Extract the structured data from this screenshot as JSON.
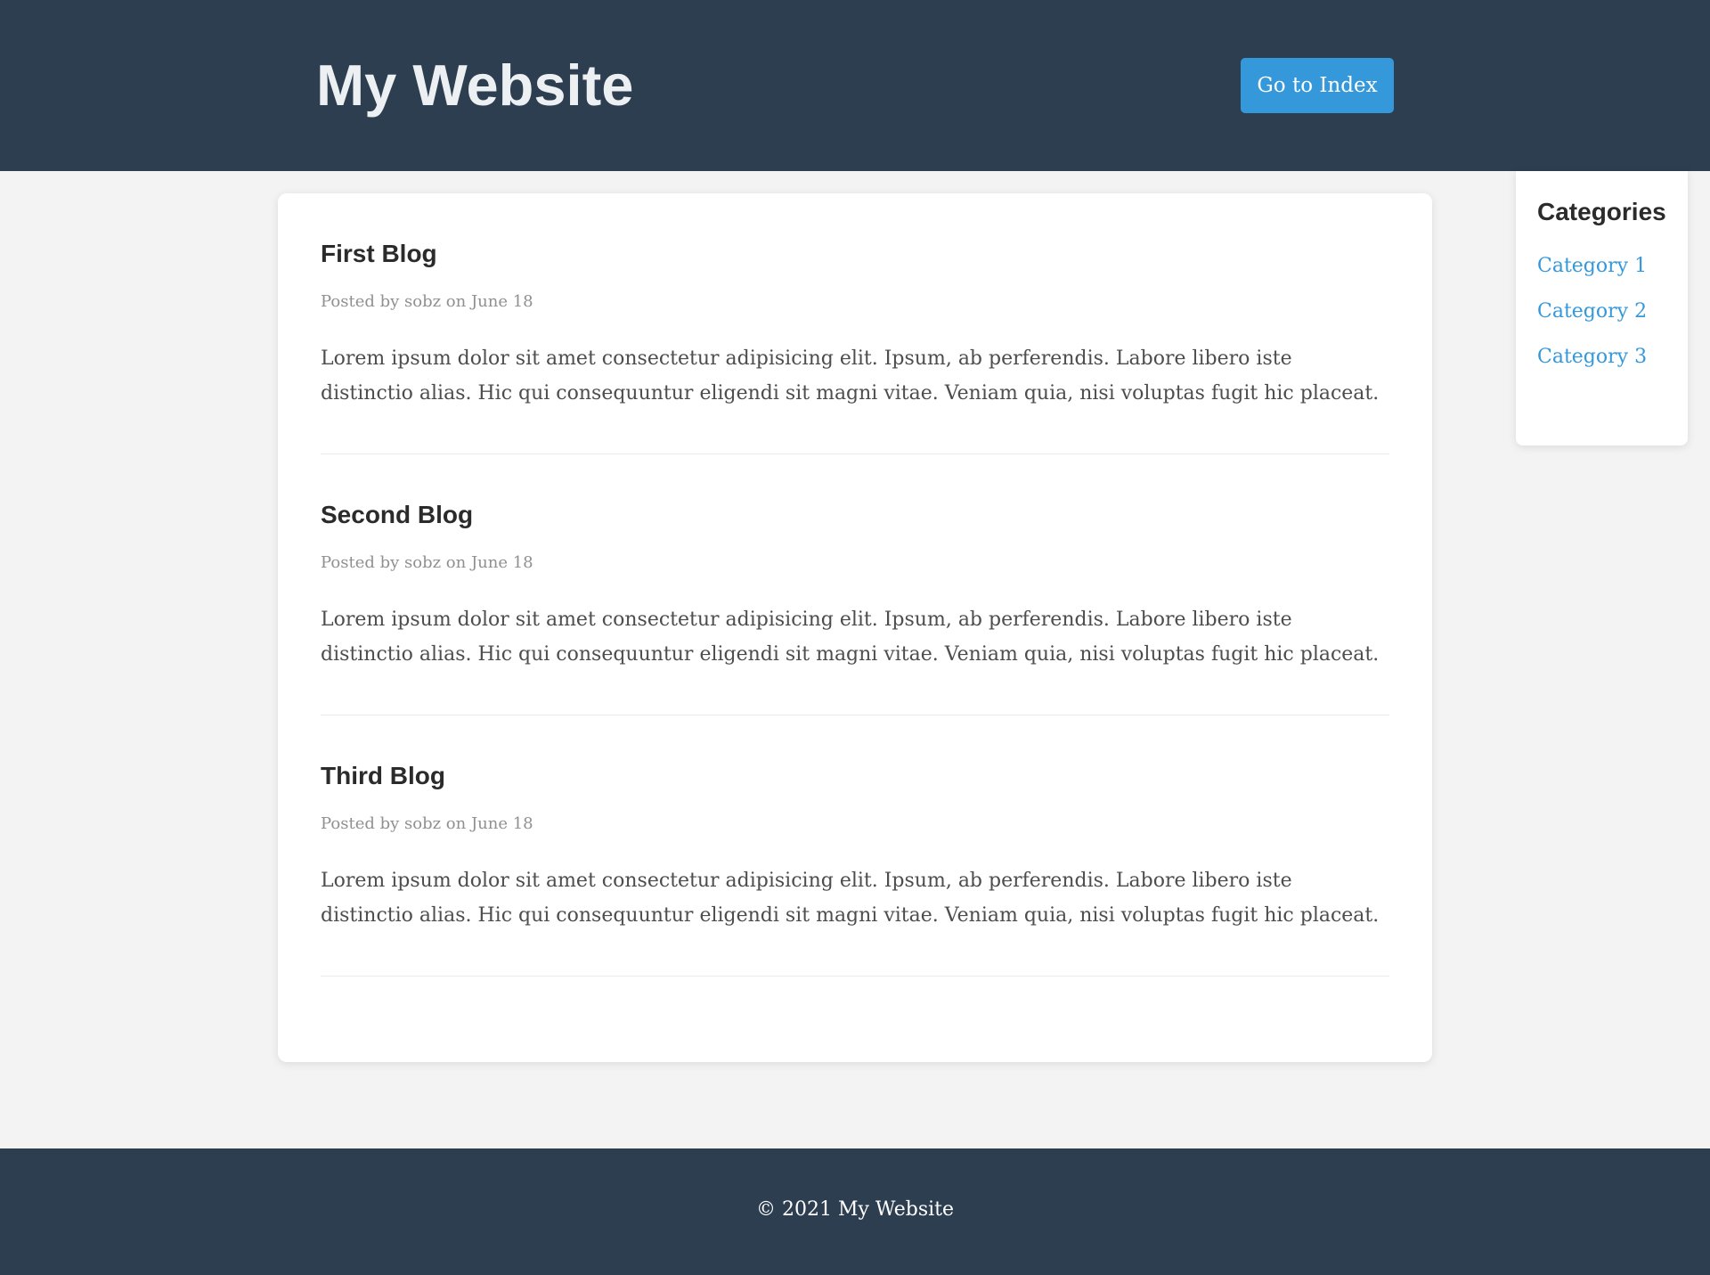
{
  "header": {
    "title": "My Website",
    "index_button_label": "Go to Index"
  },
  "posts": [
    {
      "title": "First Blog",
      "meta": "Posted by sobz on June 18",
      "body": "Lorem ipsum dolor sit amet consectetur adipisicing elit. Ipsum, ab perferendis. Labore libero iste distinctio alias. Hic qui consequuntur eligendi sit magni vitae. Veniam quia, nisi voluptas fugit hic placeat."
    },
    {
      "title": "Second Blog",
      "meta": "Posted by sobz on June 18",
      "body": "Lorem ipsum dolor sit amet consectetur adipisicing elit. Ipsum, ab perferendis. Labore libero iste distinctio alias. Hic qui consequuntur eligendi sit magni vitae. Veniam quia, nisi voluptas fugit hic placeat."
    },
    {
      "title": "Third Blog",
      "meta": "Posted by sobz on June 18",
      "body": "Lorem ipsum dolor sit amet consectetur adipisicing elit. Ipsum, ab perferendis. Labore libero iste distinctio alias. Hic qui consequuntur eligendi sit magni vitae. Veniam quia, nisi voluptas fugit hic placeat."
    }
  ],
  "sidebar": {
    "title": "Categories",
    "categories": [
      "Category 1",
      "Category 2",
      "Category 3"
    ]
  },
  "footer": {
    "text": "© 2021 My Website"
  },
  "colors": {
    "header_bg": "#2d3e50",
    "accent": "#3498db",
    "page_bg": "#f4f3f3"
  }
}
